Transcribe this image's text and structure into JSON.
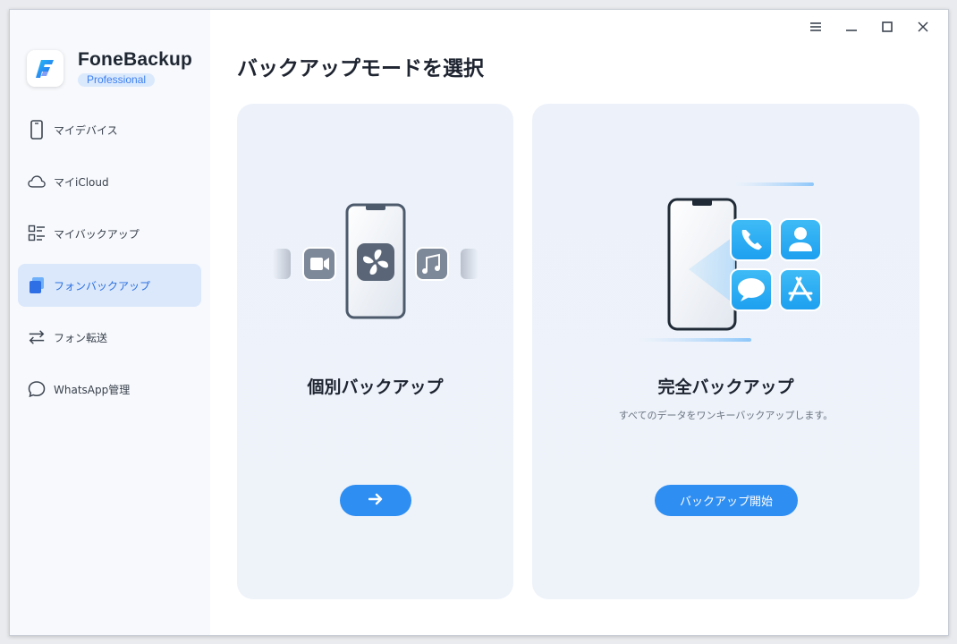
{
  "app": {
    "name": "FoneBackup",
    "edition": "Professional"
  },
  "window_controls": {
    "menu_icon": "hamburger-menu-icon",
    "minimize_icon": "minimize-icon",
    "maximize_icon": "maximize-icon",
    "close_icon": "close-icon"
  },
  "sidebar": {
    "items": [
      {
        "label": "マイデバイス",
        "icon": "phone-icon",
        "active": false
      },
      {
        "label": "マイiCloud",
        "icon": "cloud-icon",
        "active": false
      },
      {
        "label": "マイバックアップ",
        "icon": "list-icon",
        "active": false
      },
      {
        "label": "フォンバックアップ",
        "icon": "phone-backup-icon",
        "active": true
      },
      {
        "label": "フォン転送",
        "icon": "transfer-arrows-icon",
        "active": false
      },
      {
        "label": "WhatsApp管理",
        "icon": "chat-bubble-icon",
        "active": false
      }
    ]
  },
  "main": {
    "title": "バックアップモードを選択",
    "selective": {
      "title": "個別バックアップ",
      "button_icon": "arrow-right-icon"
    },
    "full": {
      "title": "完全バックアップ",
      "description": "すべてのデータをワンキーバックアップします。",
      "button_label": "バックアップ開始"
    }
  },
  "colors": {
    "accent": "#2f8ef2",
    "active_nav_bg": "#dbe8fb",
    "card_bg": "#edf2fa",
    "sidebar_bg": "#f7f9fc"
  }
}
